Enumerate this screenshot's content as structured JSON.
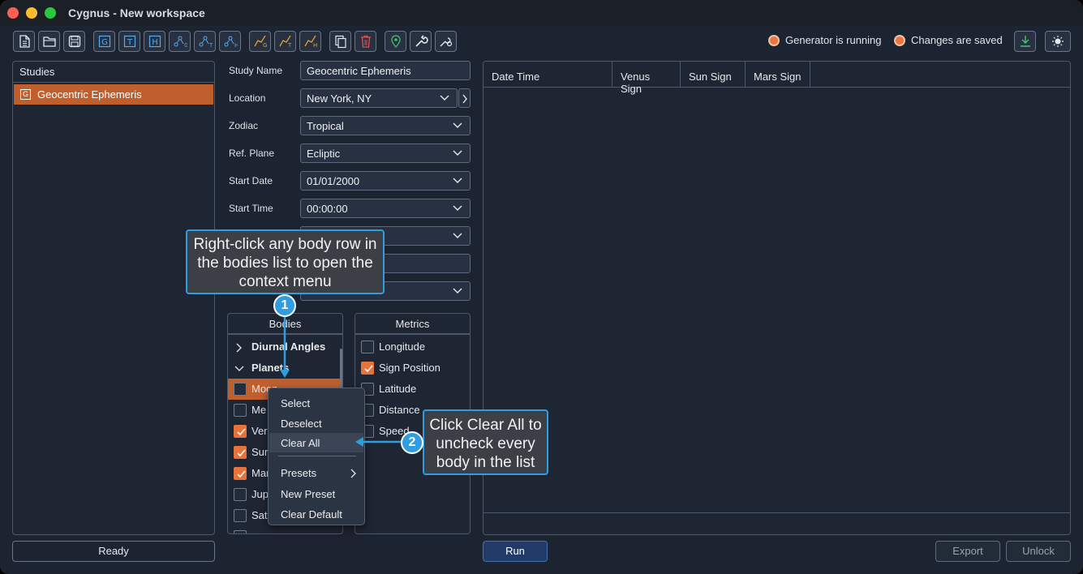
{
  "window": {
    "title": "Cygnus - New workspace"
  },
  "toolbar": {
    "icons": [
      "new-file-icon",
      "open-folder-icon",
      "save-icon",
      "geocentric-study-icon",
      "transit-study-icon",
      "heliocentric-study-icon",
      "geo-chart-icon",
      "transit-chart-icon",
      "helio-chart-icon",
      "geo-graph-icon",
      "transit-graph-icon",
      "helio-graph-icon",
      "copy-icon",
      "delete-icon",
      "location-icon",
      "wrench-icon",
      "settings-icon"
    ],
    "status_generator": "Generator is running",
    "status_saved": "Changes are saved"
  },
  "studies": {
    "title": "Studies",
    "items": [
      {
        "badge": "G",
        "name": "Geocentric Ephemeris"
      }
    ],
    "footer": "Ready"
  },
  "form": {
    "study_name": {
      "label": "Study Name",
      "value": "Geocentric Ephemeris"
    },
    "location": {
      "label": "Location",
      "value": "New York, NY"
    },
    "zodiac": {
      "label": "Zodiac",
      "value": "Tropical"
    },
    "ref_plane": {
      "label": "Ref. Plane",
      "value": "Ecliptic"
    },
    "start_date": {
      "label": "Start Date",
      "value": "01/01/2000"
    },
    "start_time": {
      "label": "Start Time",
      "value": "00:00:00"
    }
  },
  "bodies": {
    "title": "Bodies",
    "groups": [
      {
        "label": "Diurnal Angles"
      },
      {
        "label": "Planets"
      }
    ],
    "items": [
      {
        "label": "Moon",
        "checked": false
      },
      {
        "label": "Me",
        "checked": false
      },
      {
        "label": "Ver",
        "checked": true
      },
      {
        "label": "Sur",
        "checked": true
      },
      {
        "label": "Mar",
        "checked": true
      },
      {
        "label": "Jup",
        "checked": false
      },
      {
        "label": "Sat",
        "checked": false
      }
    ]
  },
  "metrics": {
    "title": "Metrics",
    "items": [
      {
        "label": "Longitude",
        "checked": false
      },
      {
        "label": "Sign Position",
        "checked": true
      },
      {
        "label": "Latitude",
        "checked": false
      },
      {
        "label": "Distance",
        "checked": false
      },
      {
        "label": "Speed",
        "checked": false
      }
    ]
  },
  "results": {
    "columns": [
      "Date Time",
      "Venus Sign",
      "Sun Sign",
      "Mars Sign"
    ]
  },
  "buttons": {
    "run": "Run",
    "export": "Export",
    "unlock": "Unlock"
  },
  "context_menu": {
    "items": [
      "Select",
      "Deselect",
      "Clear All",
      "Presets",
      "New Preset",
      "Clear Default"
    ],
    "highlighted": "Clear All"
  },
  "callouts": {
    "step1": {
      "number": "1",
      "lines": [
        "Right-click any body row in",
        "the bodies list to open the",
        "context menu"
      ]
    },
    "step2": {
      "number": "2",
      "lines": [
        "Click Clear All to",
        "uncheck every",
        "body in the list"
      ]
    }
  },
  "colors": {
    "accent_orange": "#c05f2e",
    "checkbox_orange": "#e8733a",
    "callout_blue": "#2f9de0",
    "run_blue": "#223a68"
  }
}
